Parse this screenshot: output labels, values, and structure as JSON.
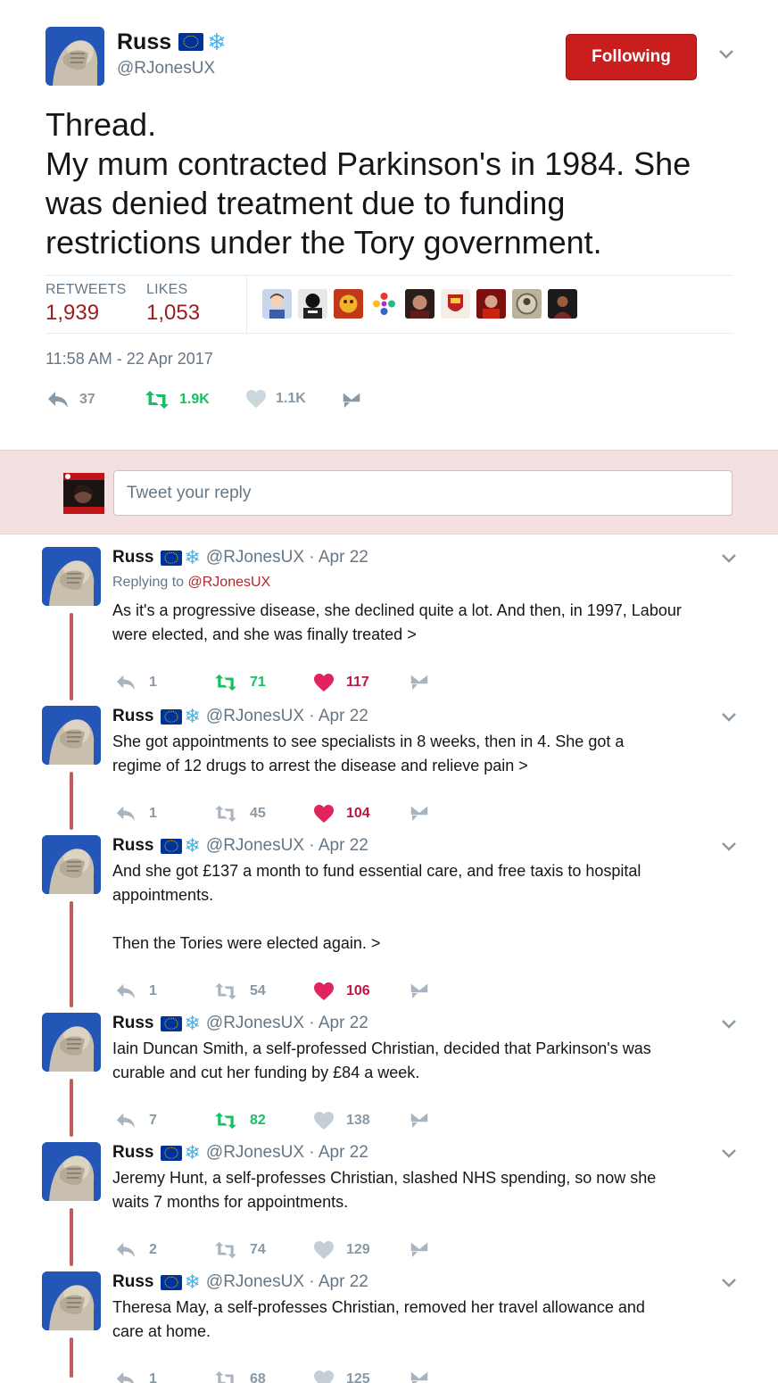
{
  "main_tweet": {
    "display_name": "Russ",
    "handle": "@RJonesUX",
    "follow_button": "Following",
    "text_lines": [
      "Thread.",
      "My mum contracted Parkinson's in 1984. She",
      "was denied treatment due to funding",
      "restrictions under the Tory government."
    ],
    "retweets_label": "RETWEETS",
    "retweets_value": "1,939",
    "likes_label": "LIKES",
    "likes_value": "1,053",
    "timestamp": "11:58 AM - 22 Apr 2017",
    "actions": {
      "replies": "37",
      "retweets": "1.9K",
      "likes": "1.1K"
    }
  },
  "reply_box": {
    "placeholder": "Tweet your reply"
  },
  "thread": [
    {
      "name": "Russ",
      "meta": "@RJonesUX · Apr 22",
      "replying_prefix": "Replying to",
      "replying_to": "@RJonesUX",
      "lines": [
        "As it's a progressive disease, she declined quite a lot. And then, in 1997, Labour",
        "were elected, and she was finally treated >"
      ],
      "replies": "1",
      "retweets": "71",
      "likes": "117",
      "retweeted": true,
      "liked": true
    },
    {
      "name": "Russ",
      "meta": "@RJonesUX · Apr 22",
      "lines": [
        "She got appointments to see specialists in 8 weeks, then in 4. She got a",
        "regime of 12 drugs to arrest the disease and relieve pain >"
      ],
      "replies": "1",
      "retweets": "45",
      "likes": "104",
      "retweeted": false,
      "liked": true
    },
    {
      "name": "Russ",
      "meta": "@RJonesUX · Apr 22",
      "lines": [
        "And she got £137 a month to fund essential care, and free taxis to hospital",
        "appointments.",
        "",
        "Then the Tories were elected again. >"
      ],
      "replies": "1",
      "retweets": "54",
      "likes": "106",
      "retweeted": false,
      "liked": true
    },
    {
      "name": "Russ",
      "meta": "@RJonesUX · Apr 22",
      "lines": [
        "Iain Duncan Smith, a self-professed Christian, decided that Parkinson's was",
        "curable and cut her funding by £84 a week."
      ],
      "replies": "7",
      "retweets": "82",
      "likes": "138",
      "retweeted": true,
      "liked": false
    },
    {
      "name": "Russ",
      "meta": "@RJonesUX · Apr 22",
      "lines": [
        "Jeremy Hunt, a self-professes Christian, slashed NHS spending, so now she",
        "waits 7 months for appointments."
      ],
      "replies": "2",
      "retweets": "74",
      "likes": "129",
      "retweeted": false,
      "liked": false
    },
    {
      "name": "Russ",
      "meta": "@RJonesUX · Apr 22",
      "lines": [
        "Theresa May, a self-professes Christian, removed her travel allowance and",
        "care at home."
      ],
      "replies": "1",
      "retweets": "68",
      "likes": "125",
      "retweeted": false,
      "liked": false
    }
  ],
  "colors": {
    "following_button": "#c81e1e",
    "count_red": "#9b1c1c",
    "retweet_green": "#17bf63",
    "like_red": "#e0245e",
    "reply_bar_bg": "#f5e0e1",
    "thread_line": "#c85a5a"
  },
  "icons": [
    "eu-flag-icon",
    "snowflake-icon",
    "chevron-down-icon",
    "reply-icon",
    "retweet-icon",
    "heart-icon",
    "message-icon"
  ]
}
